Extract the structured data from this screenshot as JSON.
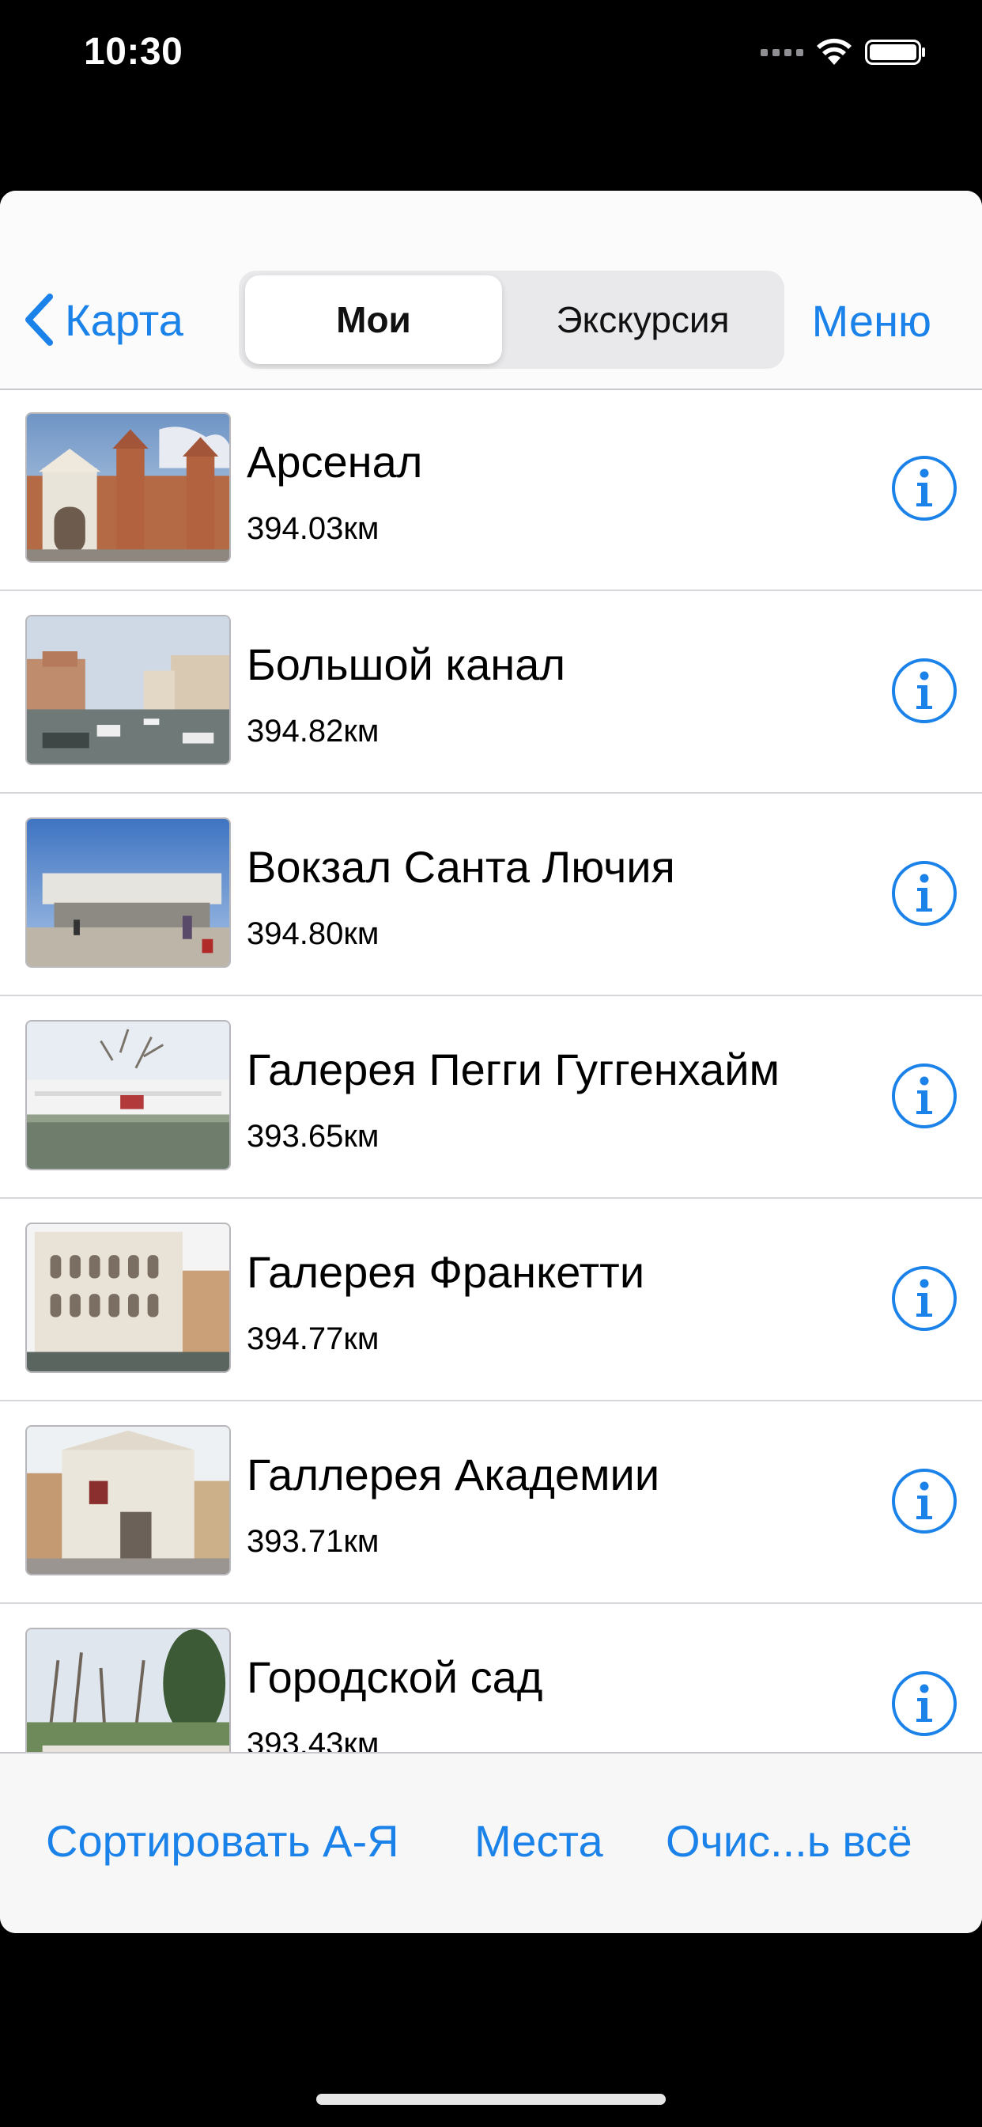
{
  "status_bar": {
    "time": "10:30"
  },
  "nav": {
    "back_label": "Карта",
    "segments": [
      "Мои",
      "Экскурсия"
    ],
    "selected_segment": "Мои",
    "menu_label": "Меню"
  },
  "places": [
    {
      "title": "Арсенал",
      "distance": "394.03км"
    },
    {
      "title": "Большой канал",
      "distance": "394.82км"
    },
    {
      "title": "Вокзал Санта Лючия",
      "distance": "394.80км"
    },
    {
      "title": "Галерея Пегги Гуггенхайм",
      "distance": "393.65км"
    },
    {
      "title": "Галерея Франкетти",
      "distance": "394.77км"
    },
    {
      "title": "Галлерея Академии",
      "distance": "393.71км"
    },
    {
      "title": "Городской сад",
      "distance": "393.43км"
    }
  ],
  "toolbar": {
    "sort_label": "Сортировать А-Я",
    "places_label": "Места",
    "clear_label": "Очис...ь всё"
  },
  "colors": {
    "accent": "#1a82e8",
    "background": "#000000",
    "sheet": "#ffffff"
  }
}
